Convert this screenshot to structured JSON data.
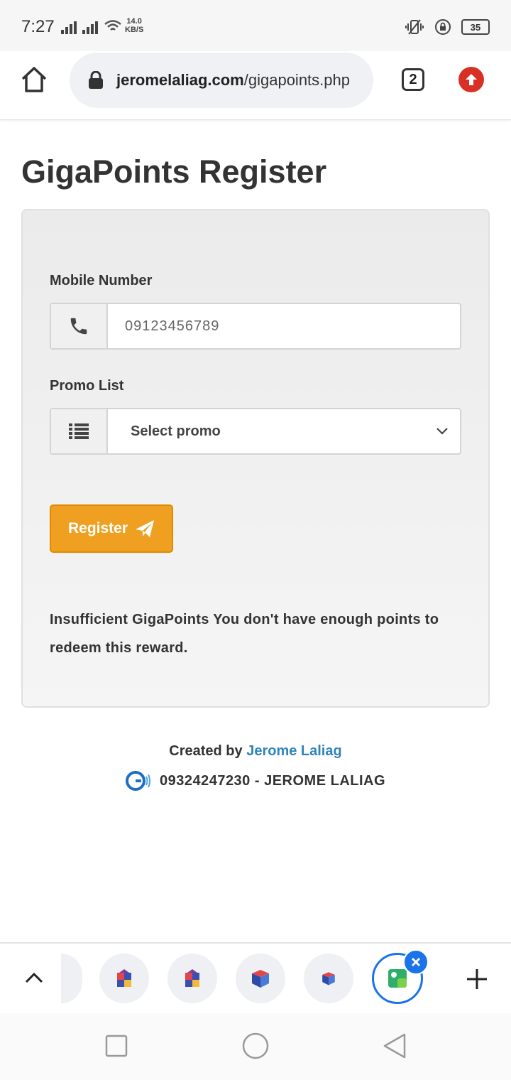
{
  "status_bar": {
    "time": "7:27",
    "net_speed_value": "14.0",
    "net_speed_unit": "KB/S",
    "battery": "35"
  },
  "browser": {
    "url_host": "jeromelaliag.com",
    "url_path": "/gigapoints.php",
    "tab_count": "2"
  },
  "page": {
    "title": "GigaPoints Register",
    "mobile_label": "Mobile Number",
    "mobile_placeholder": "09123456789",
    "promo_label": "Promo List",
    "promo_selected": "Select promo",
    "register_label": "Register",
    "notice": "Insufficient GigaPoints You don't have enough points to redeem this reward."
  },
  "footer": {
    "created_by_prefix": "Created by",
    "author_link": "Jerome Laliag",
    "contact": "09324247230 - JEROME LALIAG"
  },
  "colors": {
    "accent_orange": "#f0a020",
    "link_blue": "#2f84b8",
    "update_red": "#d93025",
    "active_tab_blue": "#1a73e8"
  }
}
